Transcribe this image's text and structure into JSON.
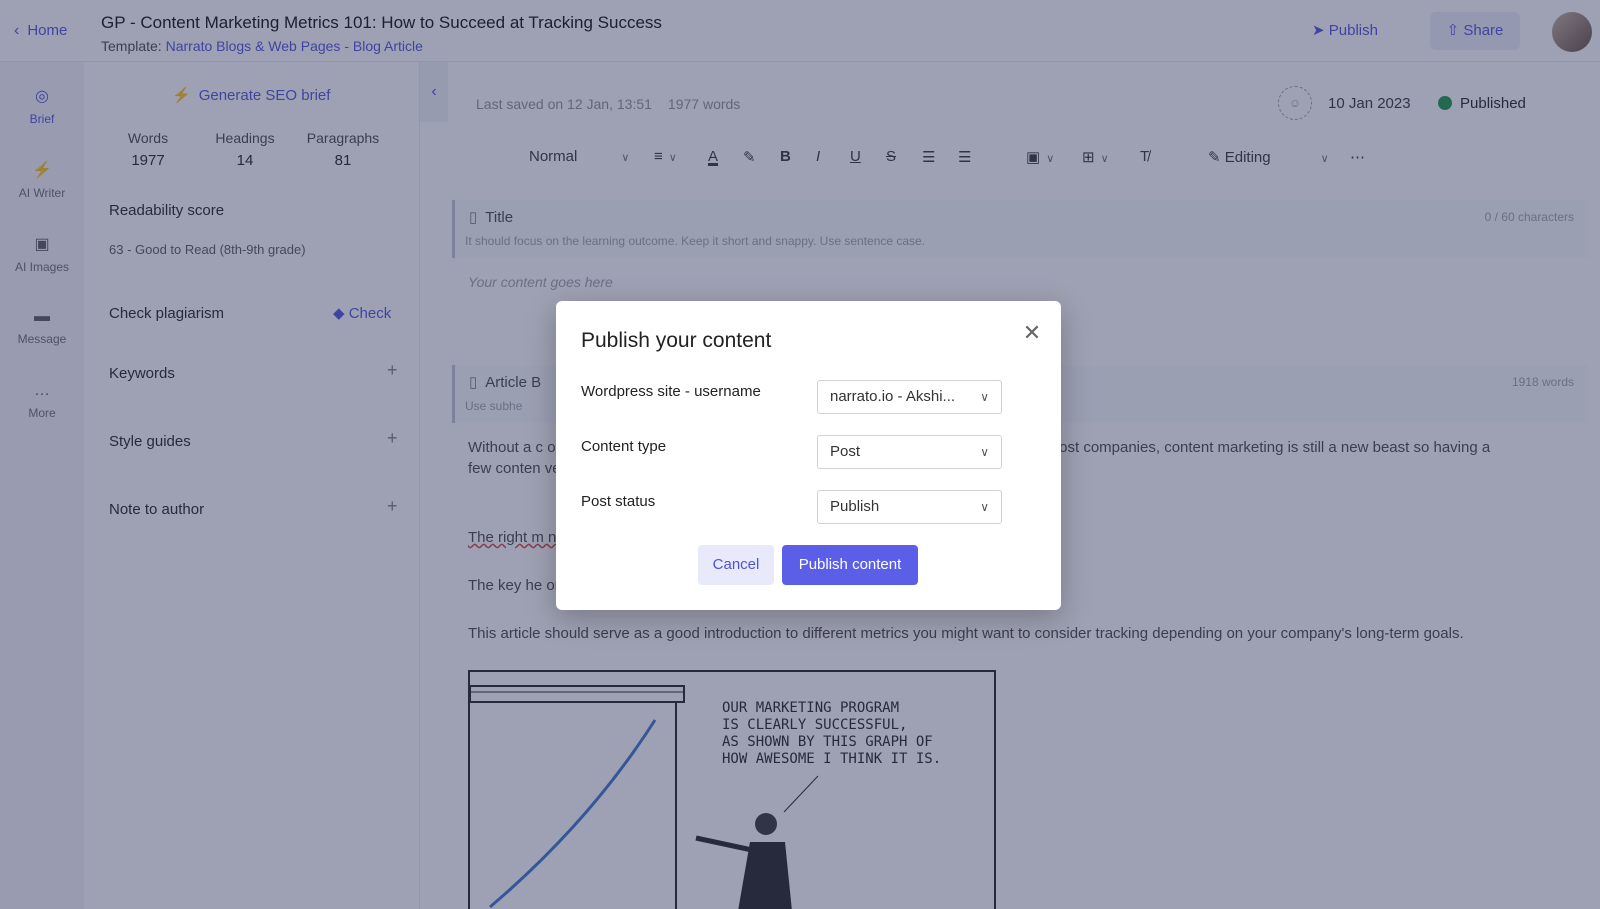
{
  "header": {
    "home_label": "Home",
    "title": "GP - Content Marketing Metrics 101: How to Succeed at Tracking Success",
    "template_prefix": "Template:",
    "template_link": "Narrato Blogs & Web Pages - Blog Article",
    "publish_label": "Publish",
    "share_label": "Share"
  },
  "leftnav": {
    "items": [
      {
        "label": "Brief",
        "icon": "target-icon"
      },
      {
        "label": "AI Writer",
        "icon": "bolt-icon"
      },
      {
        "label": "AI Images",
        "icon": "image-icon"
      },
      {
        "label": "Message",
        "icon": "message-icon"
      },
      {
        "label": "More",
        "icon": "more-icon"
      }
    ]
  },
  "brief": {
    "seo_label": "Generate SEO brief",
    "stats": [
      {
        "label": "Words",
        "value": "1977"
      },
      {
        "label": "Headings",
        "value": "14"
      },
      {
        "label": "Paragraphs",
        "value": "81"
      }
    ],
    "readability_label": "Readability score",
    "readability_value": "63 - Good to Read (8th-9th grade)",
    "plagiarism_label": "Check plagiarism",
    "check_label": "Check",
    "keywords_label": "Keywords",
    "style_guides_label": "Style guides",
    "note_label": "Note to author"
  },
  "editor": {
    "last_saved": "Last saved on 12 Jan, 13:51",
    "word_count": "1977 words",
    "date": "10 Jan 2023",
    "status": "Published",
    "toolbar": {
      "style": "Normal",
      "mode": "Editing"
    },
    "title_section": {
      "label": "Title",
      "count": "0 / 60 characters",
      "hint": "It should focus on the learning outcome. Keep it short and snappy. Use sentence case.",
      "placeholder": "Your content goes here"
    },
    "body_section": {
      "label": "Article B",
      "count": "1918 words",
      "hint": "Use subhe"
    },
    "paragraphs": [
      "Without a c                                                                                                      o ads, billboards, and flyers targeting the end user with a product or service t                                                                                              ost companies, content marketing is still a new beast so having a few conten                                                                                              ve. It will help your company use resources where they are giving the best re",
      "The right m                                                                                                      nderstand what strategies to keep and when it is time to get back to the draw",
      "The key he                                                                                                       on a few content marketing metrics that are important to your goals.",
      "This article should serve as a good introduction to different metrics you might want to consider tracking depending on your company's long-term goals."
    ],
    "cartoon_text": "OUR MARKETING PROGRAM\nIS CLEARLY SUCCESSFUL,\nAS SHOWN BY THIS GRAPH OF\nHOW AWESOME I THINK IT IS."
  },
  "modal": {
    "title": "Publish your content",
    "fields": [
      {
        "label": "Wordpress site - username",
        "value": "narrato.io - Akshi..."
      },
      {
        "label": "Content type",
        "value": "Post"
      },
      {
        "label": "Post status",
        "value": "Publish"
      }
    ],
    "cancel_label": "Cancel",
    "publish_label": "Publish content"
  },
  "colors": {
    "accent": "#5b5fe8",
    "status_green": "#2e9e55",
    "overlay": "#181e4b"
  }
}
